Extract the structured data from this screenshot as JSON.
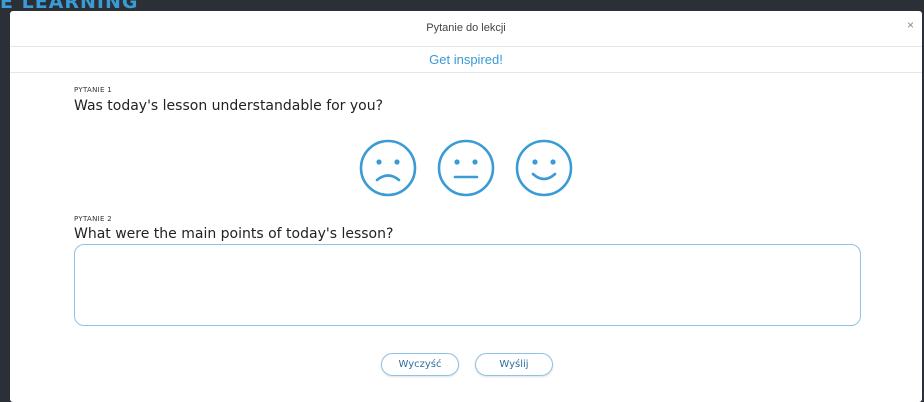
{
  "backdrop": {
    "heading": "E LEARNING"
  },
  "modal": {
    "title": "Pytanie do lekcji",
    "close_symbol": "×",
    "inspire_label": "Get inspired!"
  },
  "questions": [
    {
      "number_label": "PYTANIE 1",
      "text": "Was today's lesson understandable for you?",
      "type": "emoji-rating",
      "options": [
        "sad-face-icon",
        "neutral-face-icon",
        "happy-face-icon"
      ]
    },
    {
      "number_label": "PYTANIE 2",
      "text": "What were the main points of today's lesson?",
      "type": "text",
      "value": ""
    }
  ],
  "buttons": {
    "clear_label": "Wyczyść",
    "send_label": "Wyślij"
  },
  "colors": {
    "accent": "#3a9bd5",
    "border": "#8fc3e4",
    "backdrop": "#2b2f36"
  }
}
